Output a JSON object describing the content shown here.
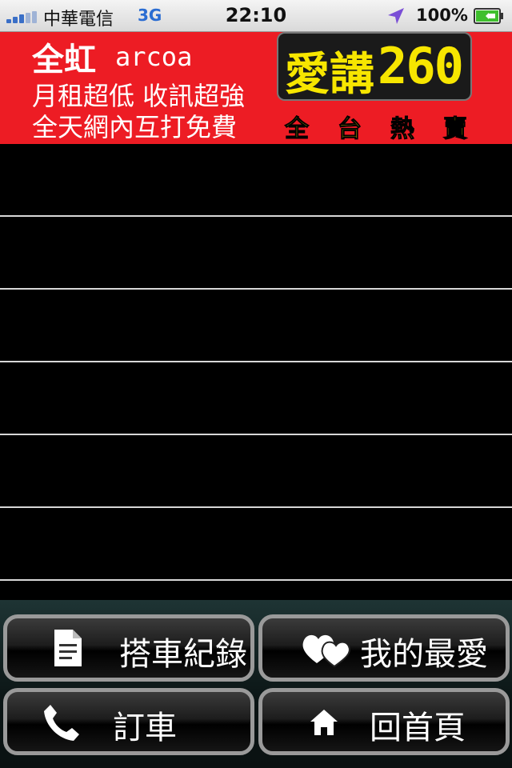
{
  "status_bar": {
    "carrier": "中華電信",
    "network": "3G",
    "time": "22:10",
    "battery": "100%",
    "icons": [
      "signal-icon",
      "location-arrow-icon",
      "battery-charging-icon"
    ]
  },
  "ad": {
    "brand": "全虹",
    "brand_en": "arcoa",
    "line1": "月租超低 收訊超強",
    "line2": "全天網內互打免費",
    "plan_name": "愛講",
    "plan_number": "260",
    "hot_chars": [
      "全",
      "台",
      "熱",
      "賣"
    ],
    "colors": {
      "background": "#ed1c24",
      "accent": "#f7e600"
    }
  },
  "list": {
    "rows": [
      "",
      "",
      "",
      "",
      "",
      ""
    ]
  },
  "toolbar": {
    "ride_history": {
      "label": "搭車紀錄",
      "icon": "document-icon"
    },
    "favorites": {
      "label": "我的最愛",
      "icon": "hearts-icon"
    },
    "book_ride": {
      "label": "訂車",
      "icon": "phone-icon"
    },
    "home": {
      "label": "回首頁",
      "icon": "home-icon"
    }
  }
}
